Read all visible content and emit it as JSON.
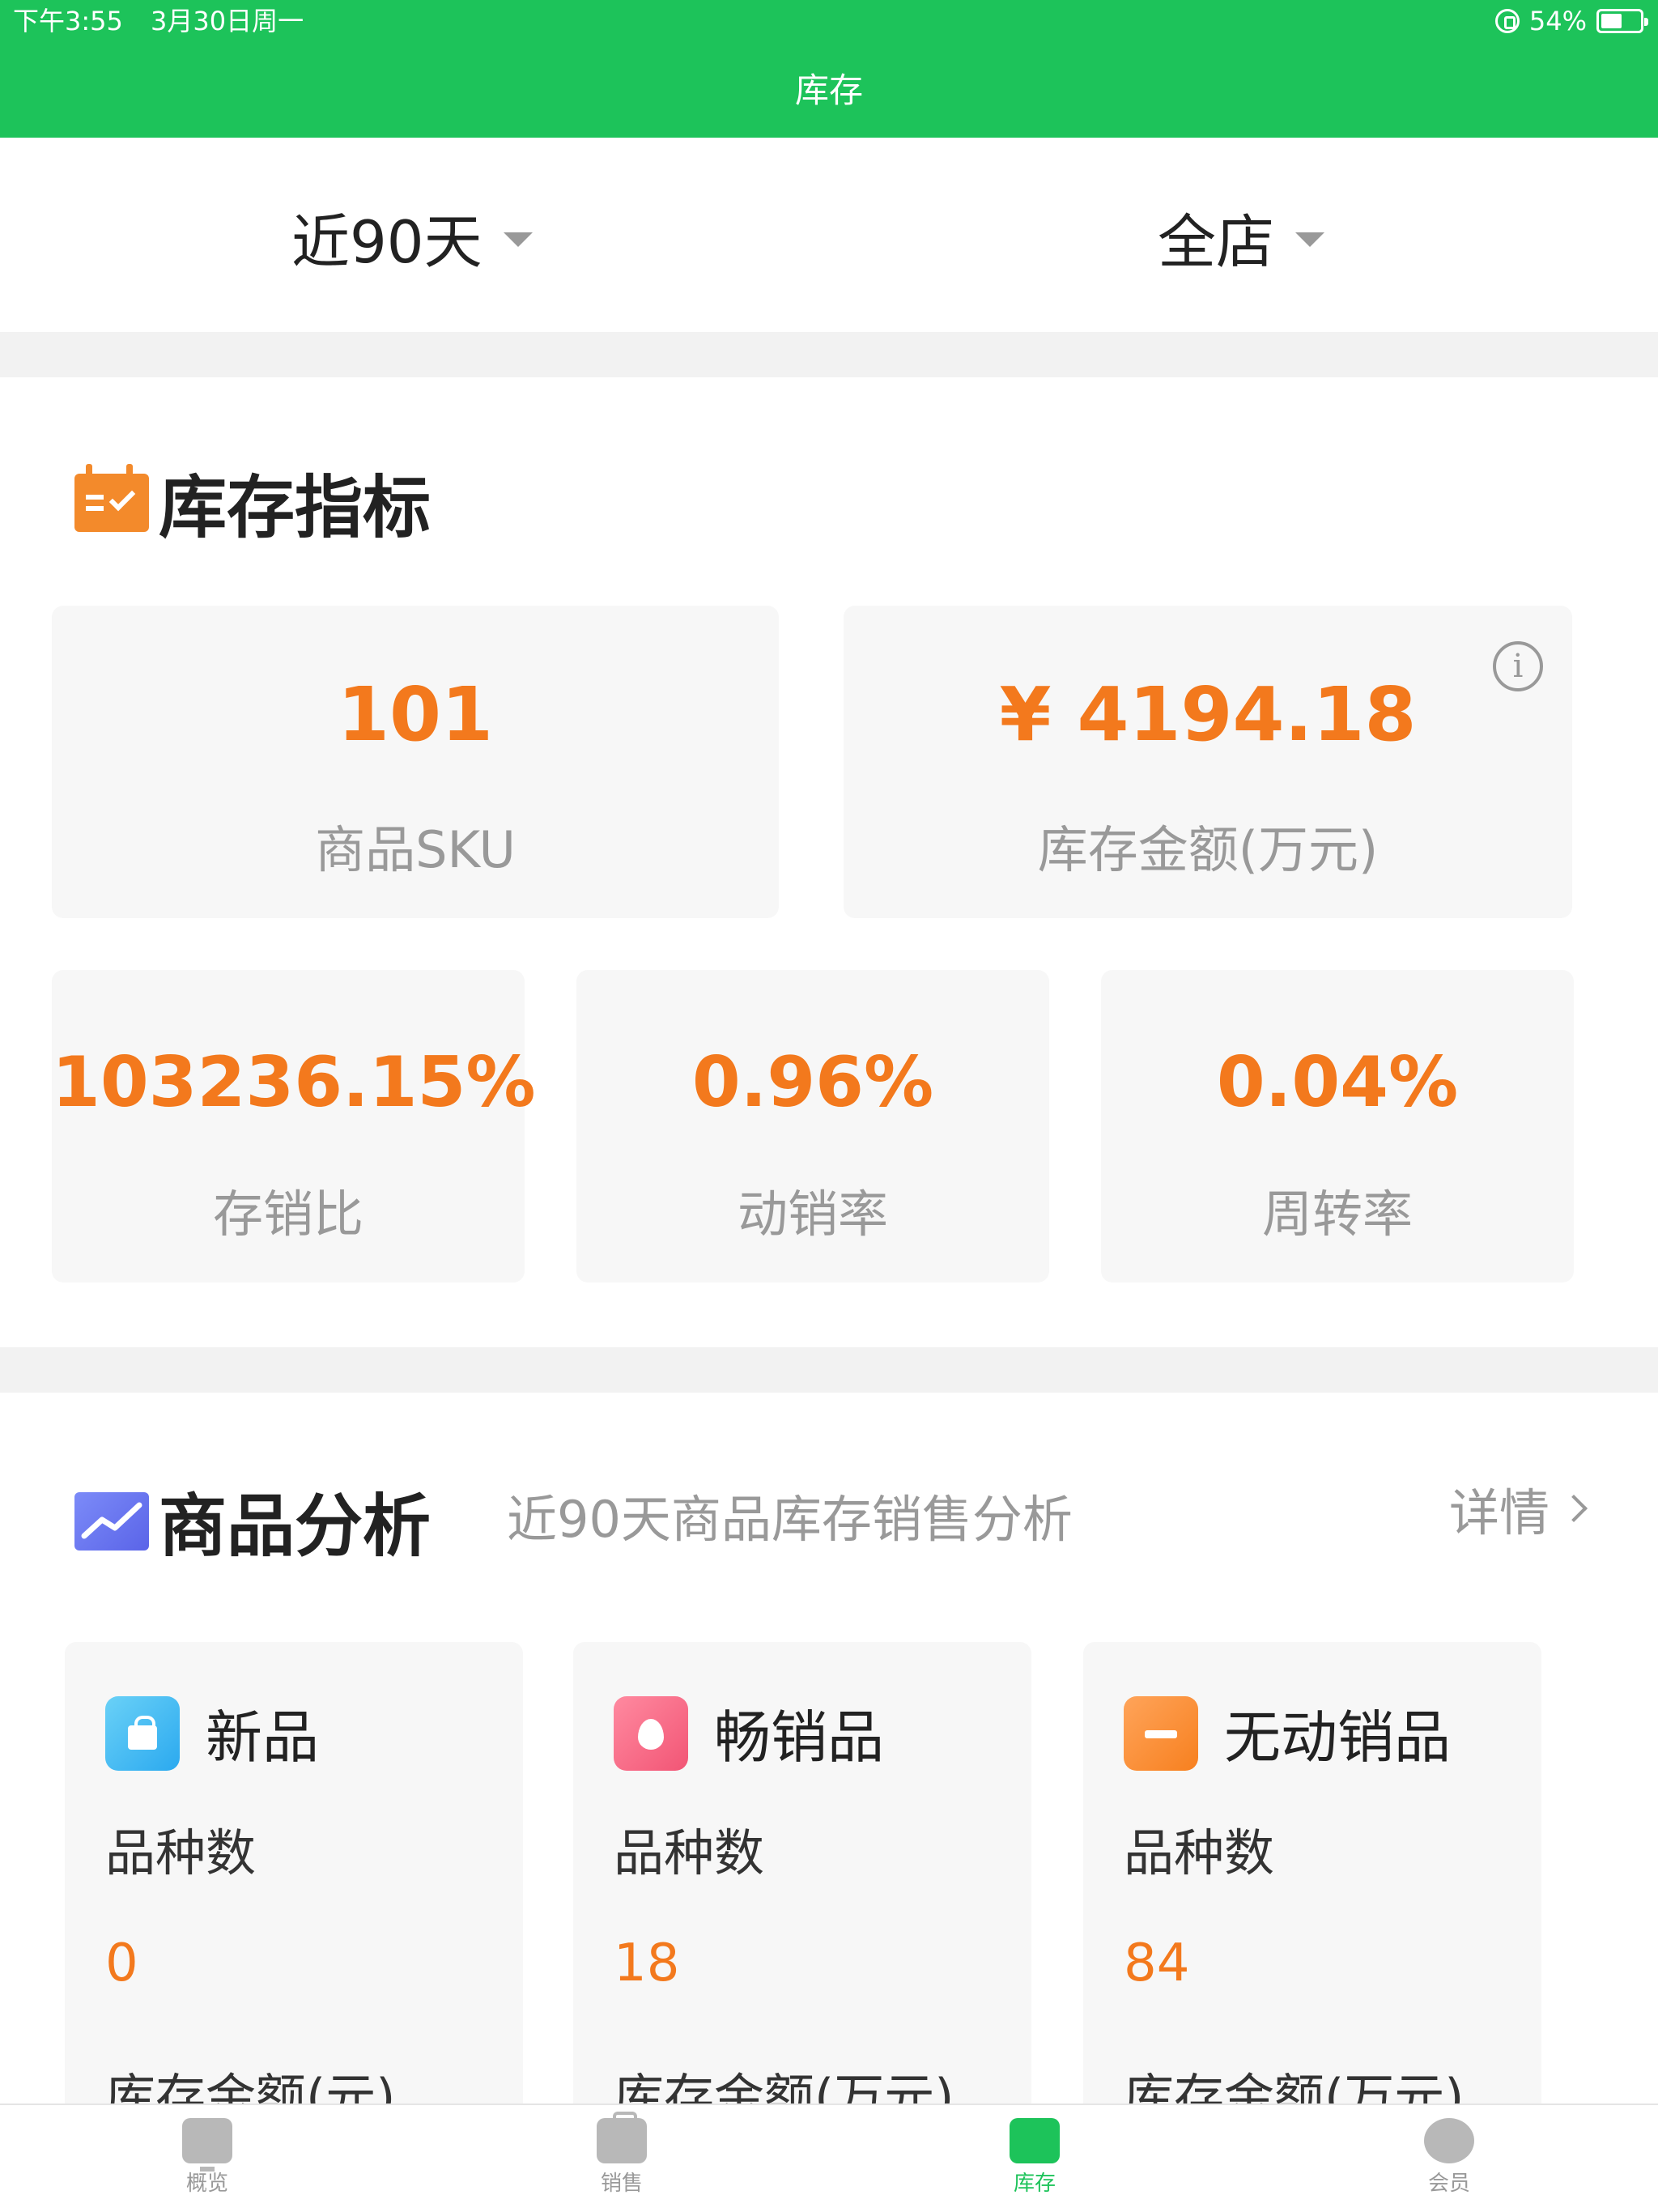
{
  "status_bar": {
    "time": "下午3:55",
    "date": "3月30日周一",
    "battery_percent": "54%",
    "battery_level": 0.54
  },
  "nav": {
    "title": "库存"
  },
  "filters": {
    "period": "近90天",
    "store": "全店"
  },
  "inventory_metrics": {
    "title": "库存指标",
    "sku": {
      "value": "101",
      "label": "商品SKU"
    },
    "amount": {
      "value": "¥ 4194.18",
      "label": "库存金额(万元)"
    },
    "stock_sales_ratio": {
      "value": "103236.15%",
      "label": "存销比"
    },
    "sell_through_rate": {
      "value": "0.96%",
      "label": "动销率"
    },
    "turnover_rate": {
      "value": "0.04%",
      "label": "周转率"
    }
  },
  "product_analysis": {
    "title": "商品分析",
    "subtitle": "近90天商品库存销售分析",
    "details_label": "详情",
    "cards": [
      {
        "title": "新品",
        "count_label": "品种数",
        "count": "0",
        "amount_label": "库存金额(元)",
        "icon": "bag-icon",
        "color": "#2ba9ef"
      },
      {
        "title": "畅销品",
        "count_label": "品种数",
        "count": "18",
        "amount_label": "库存金额(万元)",
        "icon": "fire-icon",
        "color": "#f25575"
      },
      {
        "title": "无动销品",
        "count_label": "品种数",
        "count": "84",
        "amount_label": "库存金额(万元)",
        "icon": "minus-icon",
        "color": "#f7801f"
      }
    ]
  },
  "tabbar": {
    "items": [
      {
        "label": "概览",
        "icon": "monitor-icon",
        "active": false
      },
      {
        "label": "销售",
        "icon": "briefcase-icon",
        "active": false
      },
      {
        "label": "库存",
        "icon": "bookmark-icon",
        "active": true
      },
      {
        "label": "会员",
        "icon": "member-icon",
        "active": false
      }
    ]
  },
  "colors": {
    "brand_green": "#1dc35a",
    "value_orange": "#f3791d",
    "muted_text": "#999999",
    "card_bg": "#f7f7f7"
  }
}
